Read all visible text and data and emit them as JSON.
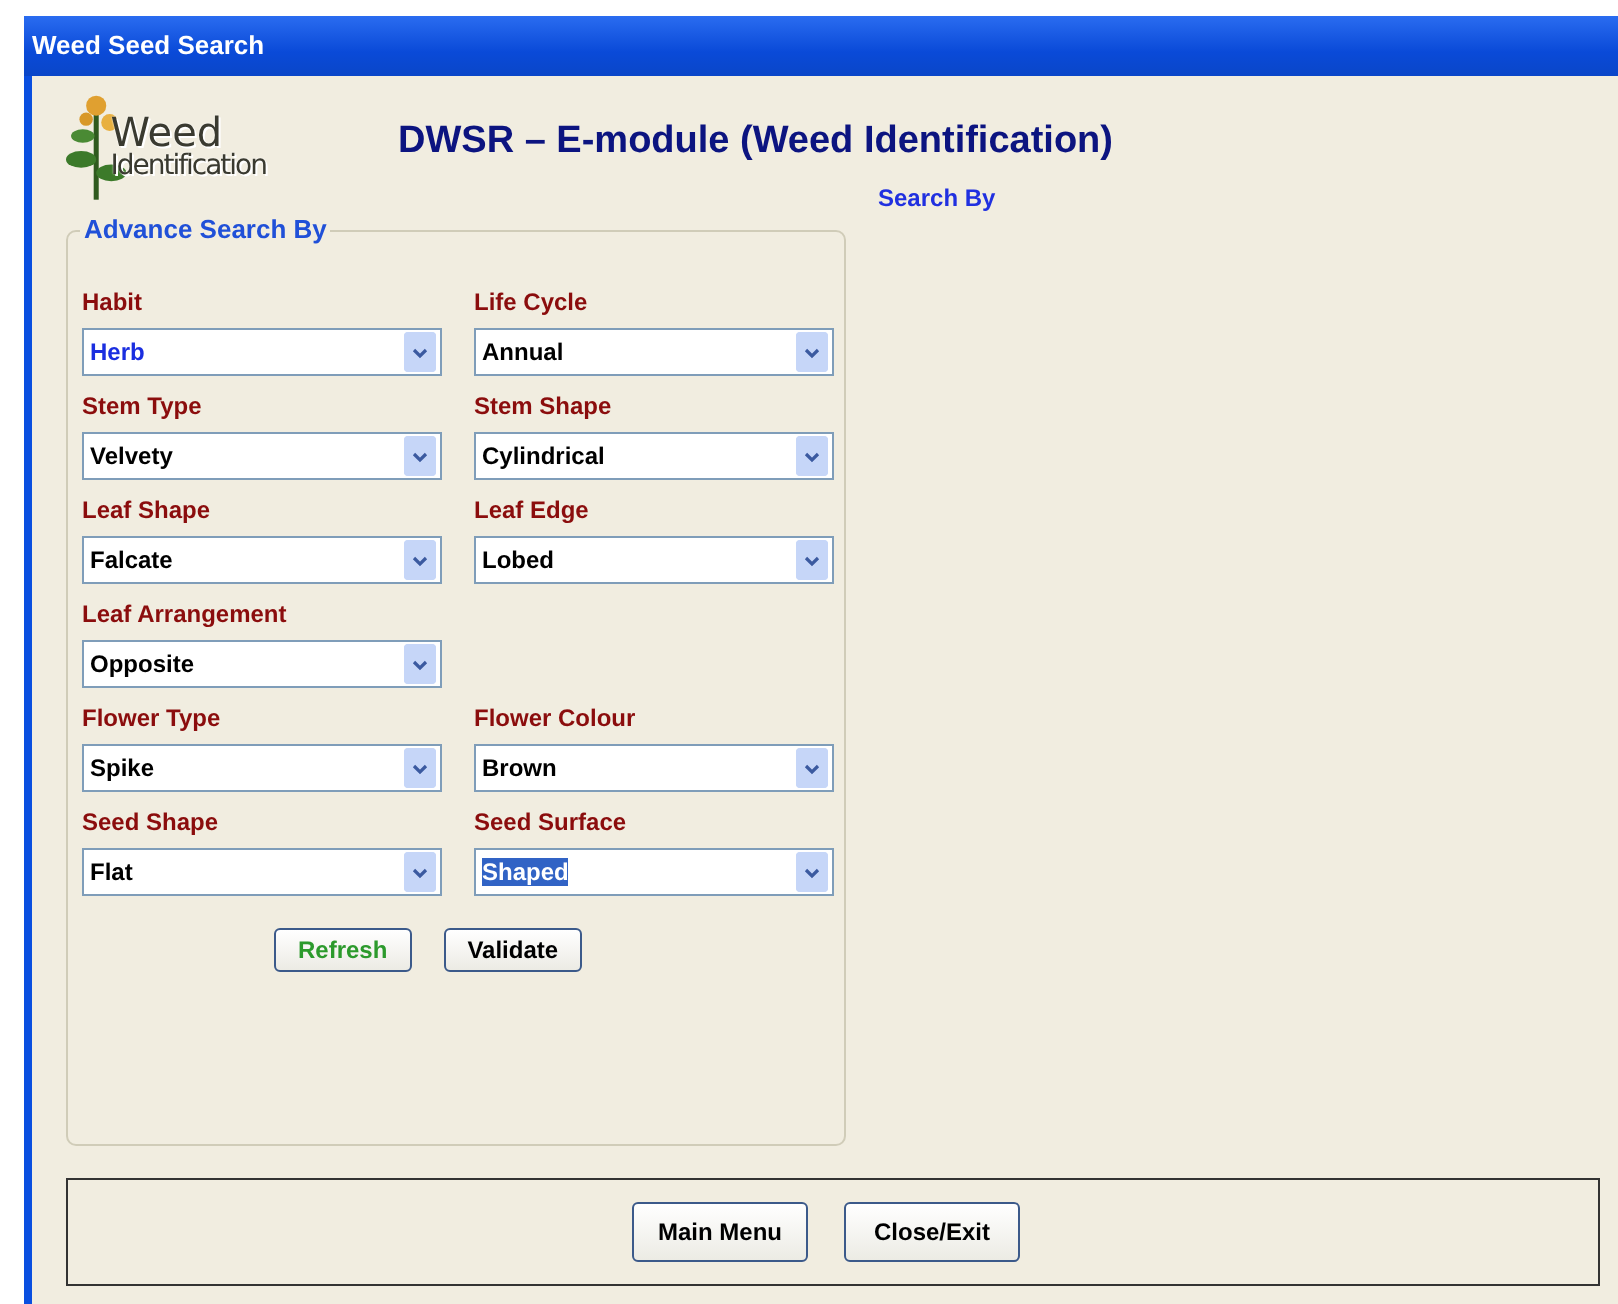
{
  "window": {
    "title": "Weed Seed Search"
  },
  "logo": {
    "line_1": "Weed",
    "line_2": "Identification"
  },
  "heading": "DWSR – E-module (Weed Identification)",
  "search_by_label": "Search By",
  "advance_search": {
    "legend": "Advance Search By",
    "rows": [
      {
        "fields": [
          {
            "label": "Habit",
            "value": "Herb",
            "highlighted": true,
            "text_selected": false
          },
          {
            "label": "Life Cycle",
            "value": "Annual",
            "highlighted": false,
            "text_selected": false
          }
        ]
      },
      {
        "fields": [
          {
            "label": "Stem Type",
            "value": "Velvety",
            "highlighted": false,
            "text_selected": false
          },
          {
            "label": "Stem Shape",
            "value": "Cylindrical",
            "highlighted": false,
            "text_selected": false
          }
        ]
      },
      {
        "fields": [
          {
            "label": "Leaf Shape",
            "value": "Falcate",
            "highlighted": false,
            "text_selected": false
          },
          {
            "label": "Leaf Edge",
            "value": "Lobed",
            "highlighted": false,
            "text_selected": false
          }
        ]
      },
      {
        "fields": [
          {
            "label": "Leaf Arrangement",
            "value": "Opposite",
            "highlighted": false,
            "text_selected": false
          }
        ]
      },
      {
        "fields": [
          {
            "label": "Flower Type",
            "value": "Spike",
            "highlighted": false,
            "text_selected": false
          },
          {
            "label": "Flower Colour",
            "value": "Brown",
            "highlighted": false,
            "text_selected": false
          }
        ]
      },
      {
        "fields": [
          {
            "label": "Seed Shape",
            "value": "Flat",
            "highlighted": false,
            "text_selected": false
          },
          {
            "label": "Seed Surface",
            "value": "Shaped",
            "highlighted": false,
            "text_selected": true
          }
        ]
      }
    ],
    "buttons": [
      {
        "label": "Refresh",
        "kind": "green"
      },
      {
        "label": "Validate",
        "kind": "plain"
      }
    ]
  },
  "bottom_buttons": [
    "Main Menu",
    "Close/Exit"
  ]
}
